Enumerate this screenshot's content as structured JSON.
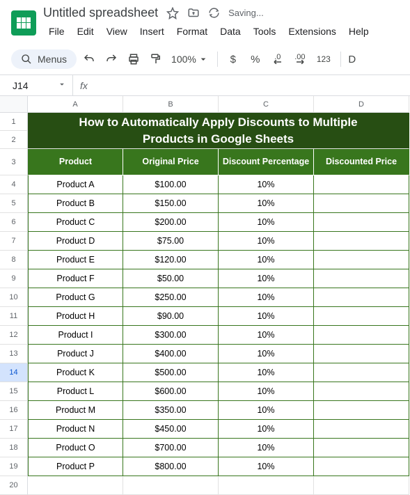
{
  "header": {
    "title": "Untitled spreadsheet",
    "saving": "Saving..."
  },
  "menubar": [
    "File",
    "Edit",
    "View",
    "Insert",
    "Format",
    "Data",
    "Tools",
    "Extensions",
    "Help"
  ],
  "toolbar": {
    "menus": "Menus",
    "zoom": "100%",
    "dollar": "$",
    "percent": "%",
    "dec_down": ".0",
    "dec_up": ".00",
    "num": "123"
  },
  "namebox": "J14",
  "fx": "fx",
  "cols": [
    "A",
    "B",
    "C",
    "D"
  ],
  "banner": {
    "line1": "How to Automatically Apply Discounts to Multiple",
    "line2": "Products in Google Sheets"
  },
  "thead": [
    "Product",
    "Original Price",
    "Discount Percentage",
    "Discounted Price"
  ],
  "rows": [
    {
      "n": "4",
      "p": "Product A",
      "o": "$100.00",
      "d": "10%",
      "dp": ""
    },
    {
      "n": "5",
      "p": "Product B",
      "o": "$150.00",
      "d": "10%",
      "dp": ""
    },
    {
      "n": "6",
      "p": "Product C",
      "o": "$200.00",
      "d": "10%",
      "dp": ""
    },
    {
      "n": "7",
      "p": "Product D",
      "o": "$75.00",
      "d": "10%",
      "dp": ""
    },
    {
      "n": "8",
      "p": "Product E",
      "o": "$120.00",
      "d": "10%",
      "dp": ""
    },
    {
      "n": "9",
      "p": "Product F",
      "o": "$50.00",
      "d": "10%",
      "dp": ""
    },
    {
      "n": "10",
      "p": "Product G",
      "o": "$250.00",
      "d": "10%",
      "dp": ""
    },
    {
      "n": "11",
      "p": "Product H",
      "o": "$90.00",
      "d": "10%",
      "dp": ""
    },
    {
      "n": "12",
      "p": "Product I",
      "o": "$300.00",
      "d": "10%",
      "dp": ""
    },
    {
      "n": "13",
      "p": "Product J",
      "o": "$400.00",
      "d": "10%",
      "dp": ""
    },
    {
      "n": "14",
      "p": "Product K",
      "o": "$500.00",
      "d": "10%",
      "dp": ""
    },
    {
      "n": "15",
      "p": "Product L",
      "o": "$600.00",
      "d": "10%",
      "dp": ""
    },
    {
      "n": "16",
      "p": "Product M",
      "o": "$350.00",
      "d": "10%",
      "dp": ""
    },
    {
      "n": "17",
      "p": "Product N",
      "o": "$450.00",
      "d": "10%",
      "dp": ""
    },
    {
      "n": "18",
      "p": "Product O",
      "o": "$700.00",
      "d": "10%",
      "dp": ""
    },
    {
      "n": "19",
      "p": "Product P",
      "o": "$800.00",
      "d": "10%",
      "dp": ""
    }
  ],
  "selected_row": "14",
  "chart_data": {
    "type": "table",
    "title": "How to Automatically Apply Discounts to Multiple Products in Google Sheets",
    "columns": [
      "Product",
      "Original Price",
      "Discount Percentage",
      "Discounted Price"
    ],
    "rows": [
      [
        "Product A",
        100.0,
        0.1,
        null
      ],
      [
        "Product B",
        150.0,
        0.1,
        null
      ],
      [
        "Product C",
        200.0,
        0.1,
        null
      ],
      [
        "Product D",
        75.0,
        0.1,
        null
      ],
      [
        "Product E",
        120.0,
        0.1,
        null
      ],
      [
        "Product F",
        50.0,
        0.1,
        null
      ],
      [
        "Product G",
        250.0,
        0.1,
        null
      ],
      [
        "Product H",
        90.0,
        0.1,
        null
      ],
      [
        "Product I",
        300.0,
        0.1,
        null
      ],
      [
        "Product J",
        400.0,
        0.1,
        null
      ],
      [
        "Product K",
        500.0,
        0.1,
        null
      ],
      [
        "Product L",
        600.0,
        0.1,
        null
      ],
      [
        "Product M",
        350.0,
        0.1,
        null
      ],
      [
        "Product N",
        450.0,
        0.1,
        null
      ],
      [
        "Product O",
        700.0,
        0.1,
        null
      ],
      [
        "Product P",
        800.0,
        0.1,
        null
      ]
    ]
  }
}
